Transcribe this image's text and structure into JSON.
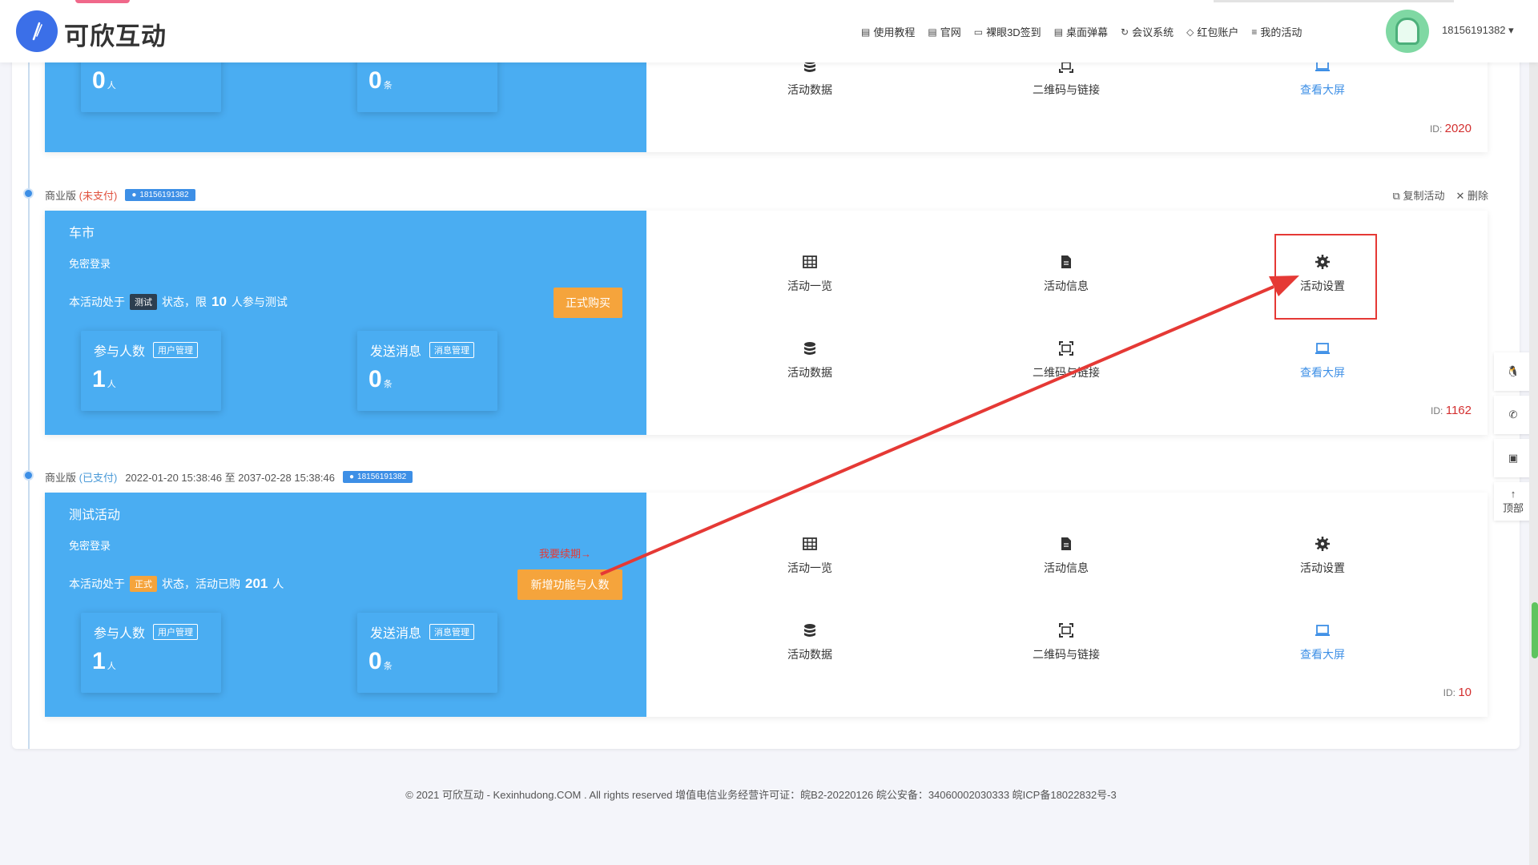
{
  "header": {
    "brand": "可欣互动",
    "nav": [
      {
        "icon": "doc-icon",
        "label": "使用教程"
      },
      {
        "icon": "doc-icon",
        "label": "官网"
      },
      {
        "icon": "monitor-icon",
        "label": "裸眼3D签到"
      },
      {
        "icon": "doc-icon",
        "label": "桌面弹幕"
      },
      {
        "icon": "refresh-icon",
        "label": "会议系统"
      },
      {
        "icon": "gem-icon",
        "label": "红包账户"
      },
      {
        "icon": "list-icon",
        "label": "我的活动"
      }
    ],
    "user_phone": "18156191382 ▾"
  },
  "common": {
    "participants_label": "参与人数",
    "user_mgmt": "用户管理",
    "messages_label": "发送消息",
    "msg_mgmt": "消息管理",
    "unit_people": "人",
    "unit_items": "条",
    "free_login": "免密登录",
    "id_prefix": "ID:",
    "actions": {
      "overview": "活动一览",
      "info": "活动信息",
      "settings": "活动设置",
      "data": "活动数据",
      "qrcode": "二维码与链接",
      "bigscreen": "查看大屏"
    }
  },
  "cards": [
    {
      "participants": "0",
      "messages": "0",
      "id": "2020"
    },
    {
      "edition": "商业版",
      "pay_status": "(未支付)",
      "user": "18156191382",
      "copy": "复制活动",
      "delete": "删除",
      "title": "车市",
      "status_prefix": "本活动处于",
      "state": "测试",
      "status_mid": "状态，限",
      "limit": "10",
      "status_suffix": "人参与测试",
      "buy": "正式购买",
      "participants": "1",
      "messages": "0",
      "id": "1162"
    },
    {
      "edition": "商业版",
      "pay_status": "(已支付)",
      "period": "2022-01-20 15:38:46 至 2037-02-28 15:38:46",
      "user": "18156191382",
      "title": "测试活动",
      "status_prefix": "本活动处于",
      "state": "正式",
      "status_mid": "状态，活动已购",
      "limit": "201",
      "status_suffix": "人",
      "renew": "我要续期→",
      "add_feature": "新增功能与人数",
      "participants": "1",
      "messages": "0",
      "id": "10"
    }
  ],
  "side_tools": {
    "top": "顶部"
  },
  "footer": "© 2021 可欣互动 - Kexinhudong.COM . All rights reserved 增值电信业务经营许可证：皖B2-20220126 皖公安备：34060002030333 皖ICP备18022832号-3"
}
